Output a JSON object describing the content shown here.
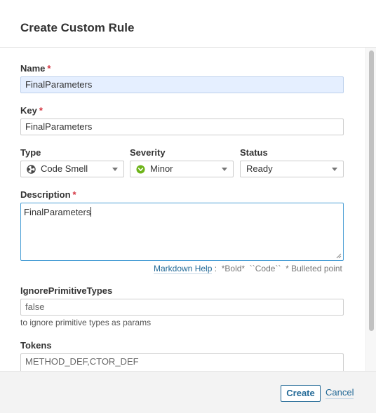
{
  "dialog": {
    "title": "Create Custom Rule"
  },
  "form": {
    "name": {
      "label": "Name",
      "required_mark": "*",
      "value": "FinalParameters"
    },
    "key": {
      "label": "Key",
      "required_mark": "*",
      "value": "FinalParameters"
    },
    "type": {
      "label": "Type",
      "value": "Code Smell",
      "icon": "code-smell-icon"
    },
    "severity": {
      "label": "Severity",
      "value": "Minor",
      "icon": "minor-severity-icon",
      "icon_color": "#6eb41a"
    },
    "status": {
      "label": "Status",
      "value": "Ready"
    },
    "description": {
      "label": "Description",
      "required_mark": "*",
      "value": "FinalParameters"
    },
    "markdown": {
      "link": "Markdown Help",
      "separator": ":",
      "bold": "*Bold*",
      "code": "``Code``",
      "bullets": "* Bulleted point"
    },
    "ignore_primitive_types": {
      "label": "IgnorePrimitiveTypes",
      "value": "false",
      "hint": "to ignore primitive types as params"
    },
    "tokens": {
      "label": "Tokens",
      "value": "METHOD_DEF,CTOR_DEF"
    }
  },
  "footer": {
    "create_label": "Create",
    "cancel_label": "Cancel"
  },
  "colors": {
    "accent": "#236a97",
    "required": "#d4333f",
    "focus_border": "#4b9fd5",
    "autofill_bg": "#e5efff"
  }
}
